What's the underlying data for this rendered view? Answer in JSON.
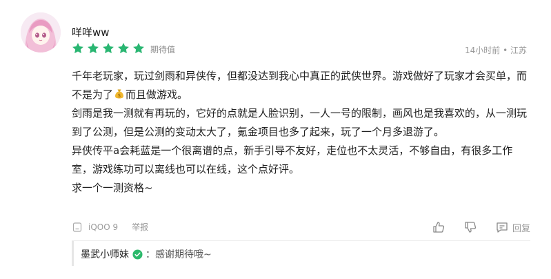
{
  "review": {
    "username": "咩咩ww",
    "rating": 5,
    "rating_label": "期待值",
    "meta": "14小时前 • 江苏",
    "paragraphs": [
      {
        "before": "千年老玩家，玩过剑雨和异侠传，但都没达到我心中真正的武侠世界。游戏做好了玩家才会买单，而不是为了",
        "after": "而且做游戏。"
      },
      {
        "text": "剑雨是我一测就有再玩的，它好的点就是人脸识别，一人一号的限制，画风也是我喜欢的，从一测玩到了公测，但是公测的变动太大了，氪金项目也多了起来，玩了一个月多退游了。"
      },
      {
        "text": "异侠传平a会耗蓝是一个很离谱的点，新手引导不友好，走位也不太灵活，不够自由，有很多工作室，游戏练功可以离线也可以在线，这个点好评。"
      },
      {
        "text": "求一个一测资格~"
      }
    ],
    "device": "iQOO 9",
    "report_label": "举报",
    "reply_label": "回复",
    "icons": [
      "money-bag-icon",
      "phone-icon",
      "thumbs-up-icon",
      "thumbs-down-icon",
      "comment-icon",
      "verified-icon"
    ]
  },
  "reply": {
    "name": "墨武小师妹",
    "separator": "：",
    "text": "感谢期待哦~"
  },
  "colors": {
    "star": "#2ab672",
    "verified": "#2cb96b",
    "muted": "#999999"
  }
}
